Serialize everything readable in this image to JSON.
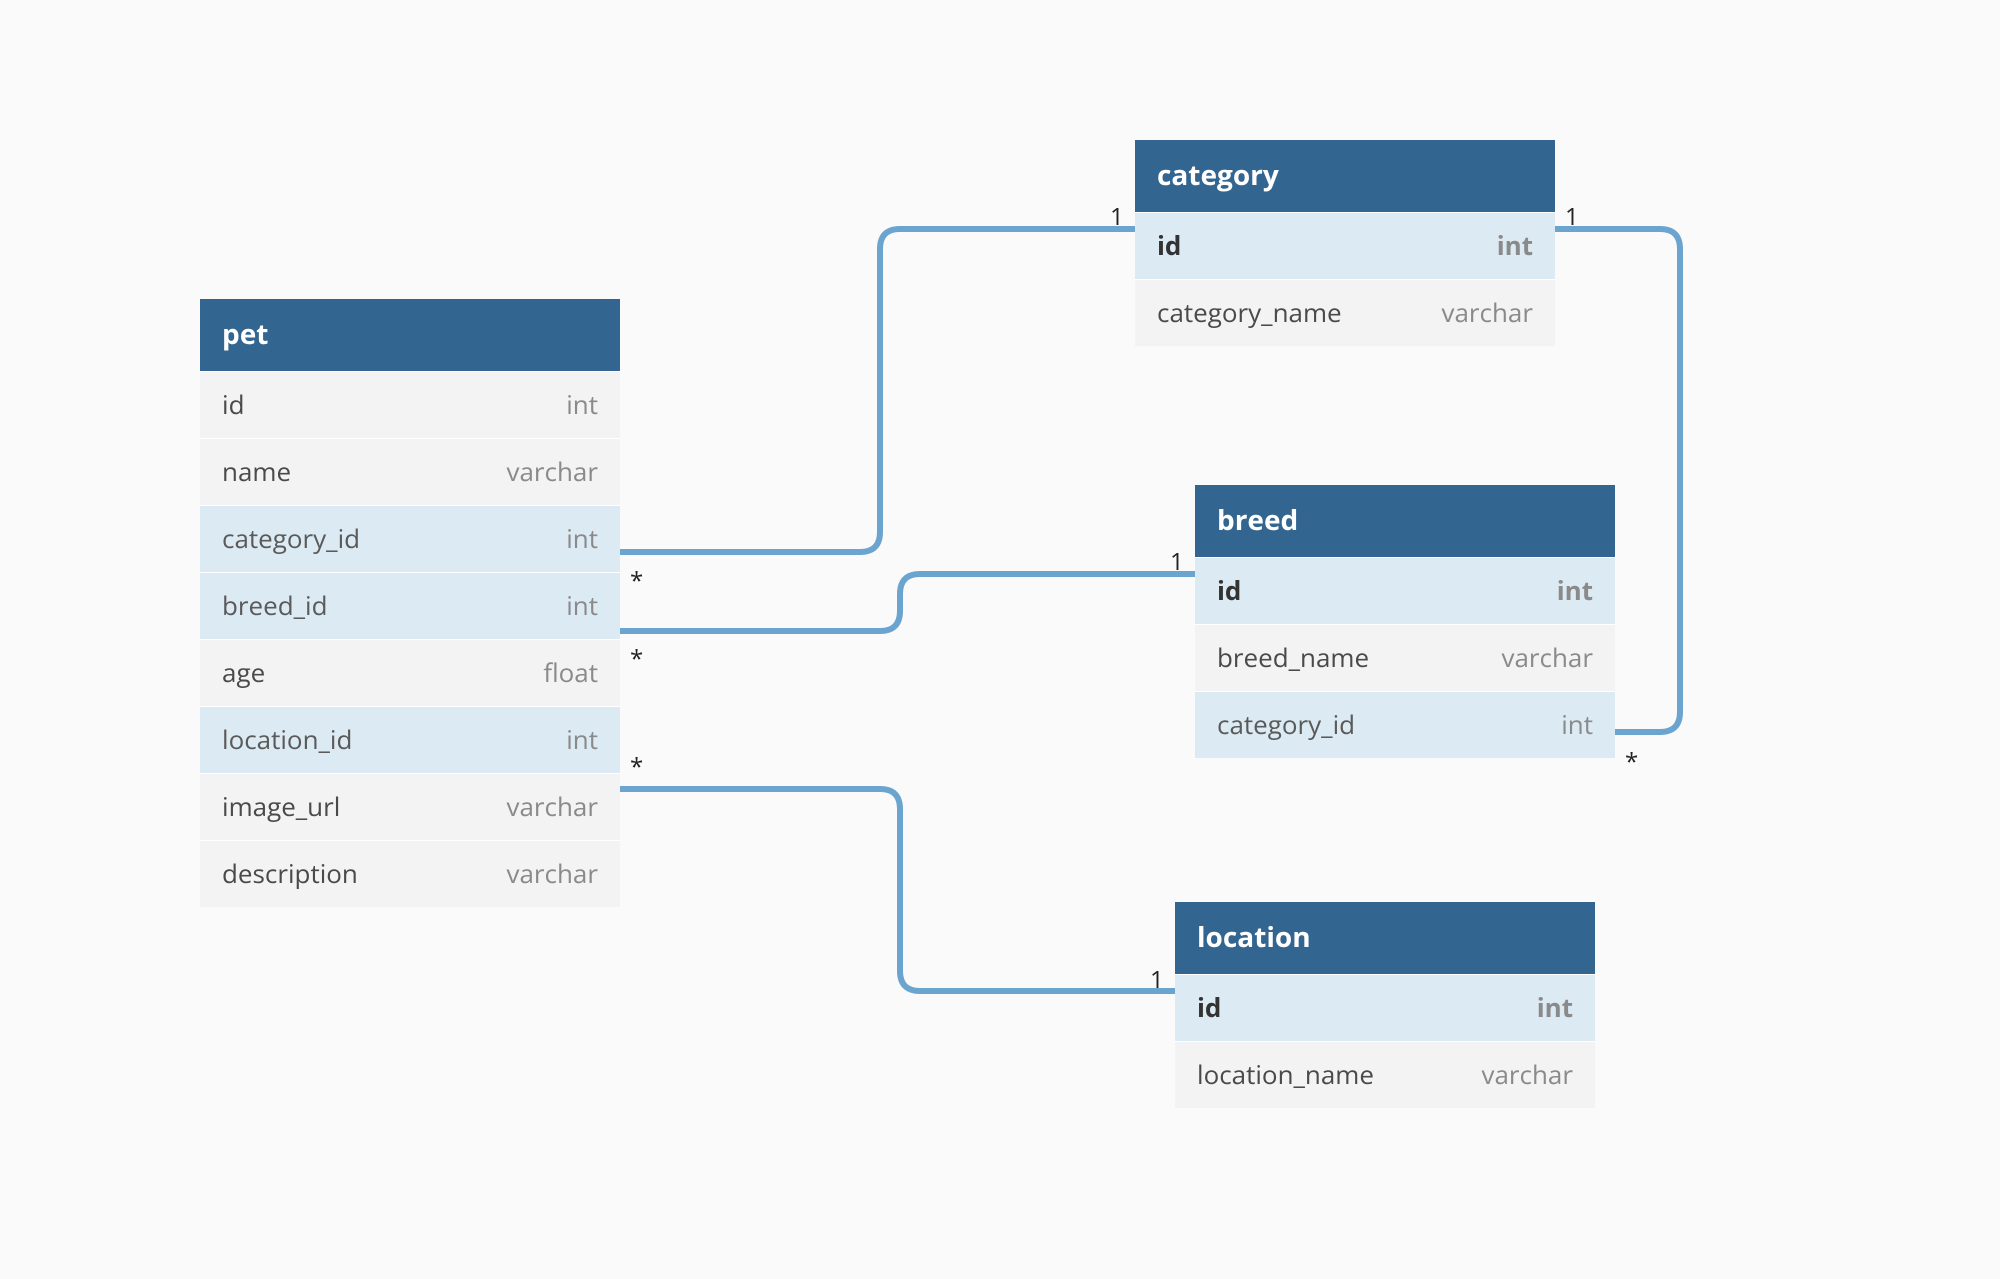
{
  "tables": {
    "pet": {
      "title": "pet",
      "columns": [
        {
          "name": "id",
          "type": "int",
          "kind": "plain"
        },
        {
          "name": "name",
          "type": "varchar",
          "kind": "plain"
        },
        {
          "name": "category_id",
          "type": "int",
          "kind": "fk"
        },
        {
          "name": "breed_id",
          "type": "int",
          "kind": "fk"
        },
        {
          "name": "age",
          "type": "float",
          "kind": "plain"
        },
        {
          "name": "location_id",
          "type": "int",
          "kind": "fk"
        },
        {
          "name": "image_url",
          "type": "varchar",
          "kind": "plain"
        },
        {
          "name": "description",
          "type": "varchar",
          "kind": "plain"
        }
      ]
    },
    "category": {
      "title": "category",
      "columns": [
        {
          "name": "id",
          "type": "int",
          "kind": "pk"
        },
        {
          "name": "category_name",
          "type": "varchar",
          "kind": "plain"
        }
      ]
    },
    "breed": {
      "title": "breed",
      "columns": [
        {
          "name": "id",
          "type": "int",
          "kind": "pk"
        },
        {
          "name": "breed_name",
          "type": "varchar",
          "kind": "plain"
        },
        {
          "name": "category_id",
          "type": "int",
          "kind": "fk"
        }
      ]
    },
    "location": {
      "title": "location",
      "columns": [
        {
          "name": "id",
          "type": "int",
          "kind": "pk"
        },
        {
          "name": "location_name",
          "type": "varchar",
          "kind": "plain"
        }
      ]
    }
  },
  "cardinality": {
    "one": "1",
    "many": "*"
  },
  "colors": {
    "header_bg": "#326690",
    "key_row_bg": "#dceaf3",
    "row_bg": "#f3f3f3",
    "connector": "#6ba4cf"
  }
}
